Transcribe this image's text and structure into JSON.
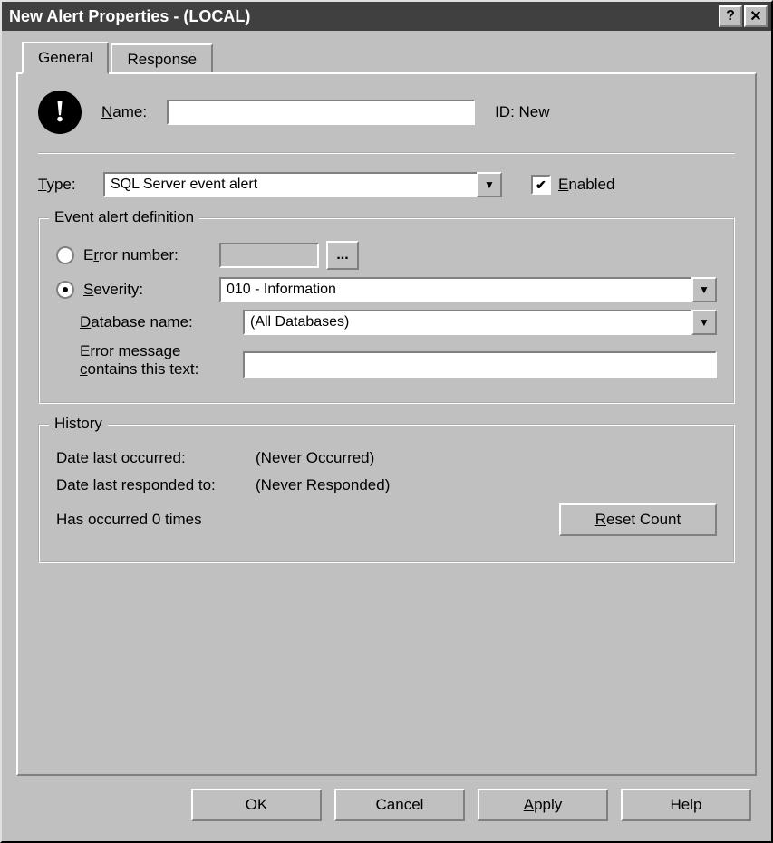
{
  "titlebar": {
    "title": "New Alert Properties - (LOCAL)"
  },
  "tabs": {
    "general": "General",
    "response": "Response"
  },
  "general": {
    "name_label": "Name:",
    "name_value": "",
    "id_label": "ID: New",
    "type_label": "Type:",
    "type_value": "SQL Server event alert",
    "enabled_label": "Enabled",
    "event_group_title": "Event alert definition",
    "error_number_label": "Error number:",
    "error_number_value": "",
    "browse_label": "...",
    "severity_label": "Severity:",
    "severity_value": "010 - Information",
    "database_label": "Database name:",
    "database_value": "(All Databases)",
    "errmsg_label1": "Error message",
    "errmsg_label2": "contains this text:",
    "errmsg_value": "",
    "history_group_title": "History",
    "date_last_occurred_label": "Date last occurred:",
    "date_last_occurred_value": "(Never Occurred)",
    "date_last_responded_label": "Date last responded to:",
    "date_last_responded_value": "(Never Responded)",
    "occur_count_label": "Has occurred 0 times",
    "reset_count_label": "Reset Count"
  },
  "buttons": {
    "ok": "OK",
    "cancel": "Cancel",
    "apply": "Apply",
    "help": "Help"
  }
}
